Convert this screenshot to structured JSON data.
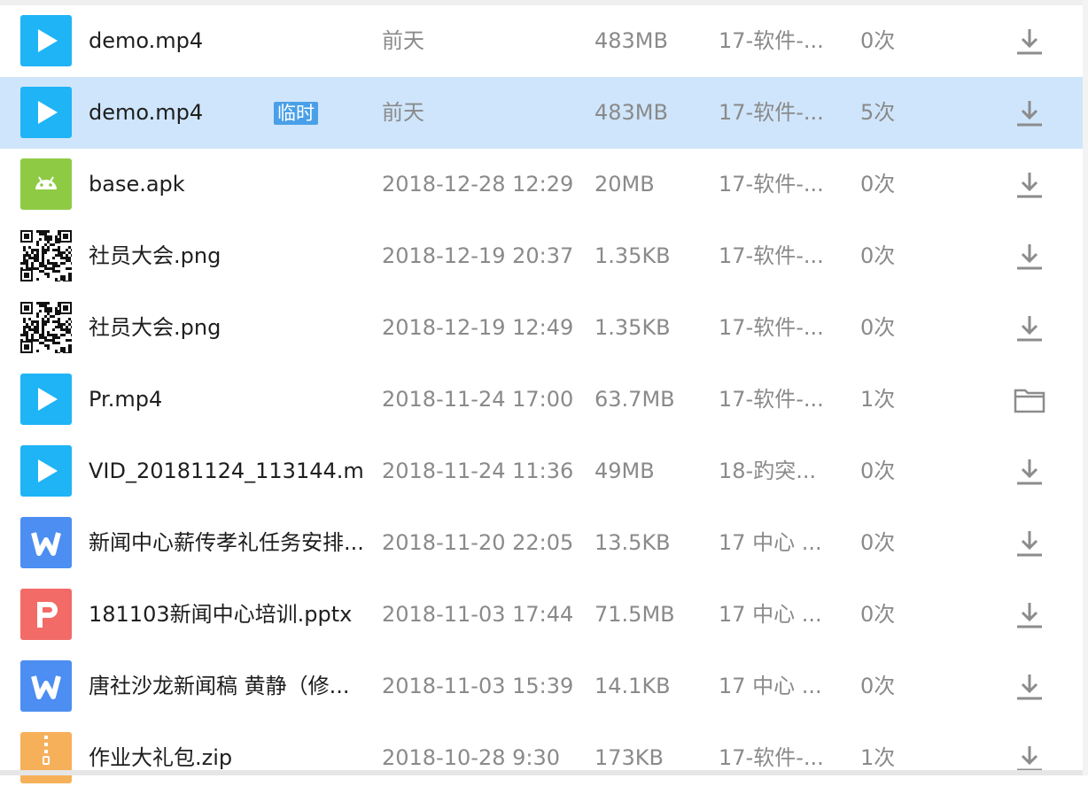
{
  "files": [
    {
      "name": "demo.mp4",
      "tag": "",
      "time": "前天",
      "size": "483MB",
      "dir": "17-软件-...",
      "count": "0次",
      "type": "video",
      "action": "download-icon",
      "selected": false
    },
    {
      "name": "demo.mp4",
      "tag": "临时",
      "time": "前天",
      "size": "483MB",
      "dir": "17-软件-...",
      "count": "5次",
      "type": "video",
      "action": "download-icon",
      "selected": true
    },
    {
      "name": "base.apk",
      "tag": "",
      "time": "2018-12-28 12:29",
      "size": "20MB",
      "dir": "17-软件-...",
      "count": "0次",
      "type": "apk",
      "action": "download-icon",
      "selected": false
    },
    {
      "name": "社员大会.png",
      "tag": "",
      "time": "2018-12-19 20:37",
      "size": "1.35KB",
      "dir": "17-软件-...",
      "count": "0次",
      "type": "qr",
      "action": "download-icon",
      "selected": false
    },
    {
      "name": "社员大会.png",
      "tag": "",
      "time": "2018-12-19 12:49",
      "size": "1.35KB",
      "dir": "17-软件-...",
      "count": "0次",
      "type": "qr",
      "action": "download-icon",
      "selected": false
    },
    {
      "name": "Pr.mp4",
      "tag": "",
      "time": "2018-11-24 17:00",
      "size": "63.7MB",
      "dir": "17-软件-...",
      "count": "1次",
      "type": "video",
      "action": "folder-icon",
      "selected": false
    },
    {
      "name": "VID_20181124_113144.m...",
      "tag": "",
      "time": "2018-11-24 11:36",
      "size": "49MB",
      "dir": "18-趵突...",
      "count": "0次",
      "type": "video",
      "action": "download-icon",
      "selected": false
    },
    {
      "name": "新闻中心薪传孝礼任务安排...",
      "tag": "",
      "time": "2018-11-20 22:05",
      "size": "13.5KB",
      "dir": "17 中心 ...",
      "count": "0次",
      "type": "word",
      "action": "download-icon",
      "selected": false
    },
    {
      "name": "181103新闻中心培训.pptx",
      "tag": "",
      "time": "2018-11-03 17:44",
      "size": "71.5MB",
      "dir": "17 中心 ...",
      "count": "0次",
      "type": "ppt",
      "action": "download-icon",
      "selected": false
    },
    {
      "name": "唐社沙龙新闻稿 黄静（修...",
      "tag": "",
      "time": "2018-11-03 15:39",
      "size": "14.1KB",
      "dir": "17 中心 ...",
      "count": "0次",
      "type": "word",
      "action": "download-icon",
      "selected": false
    },
    {
      "name": "作业大礼包.zip",
      "tag": "",
      "time": "2018-10-28 9:30",
      "size": "173KB",
      "dir": "17-软件-...",
      "count": "1次",
      "type": "zip",
      "action": "download-icon",
      "selected": false
    }
  ],
  "colors": {
    "video": "#1fb4f6",
    "apk": "#8fca45",
    "word": "#4c8ef1",
    "ppt": "#f26b67",
    "zip": "#f6b05a",
    "selected_row": "#cfe5fb",
    "tag_bg": "#4aa0e8"
  }
}
